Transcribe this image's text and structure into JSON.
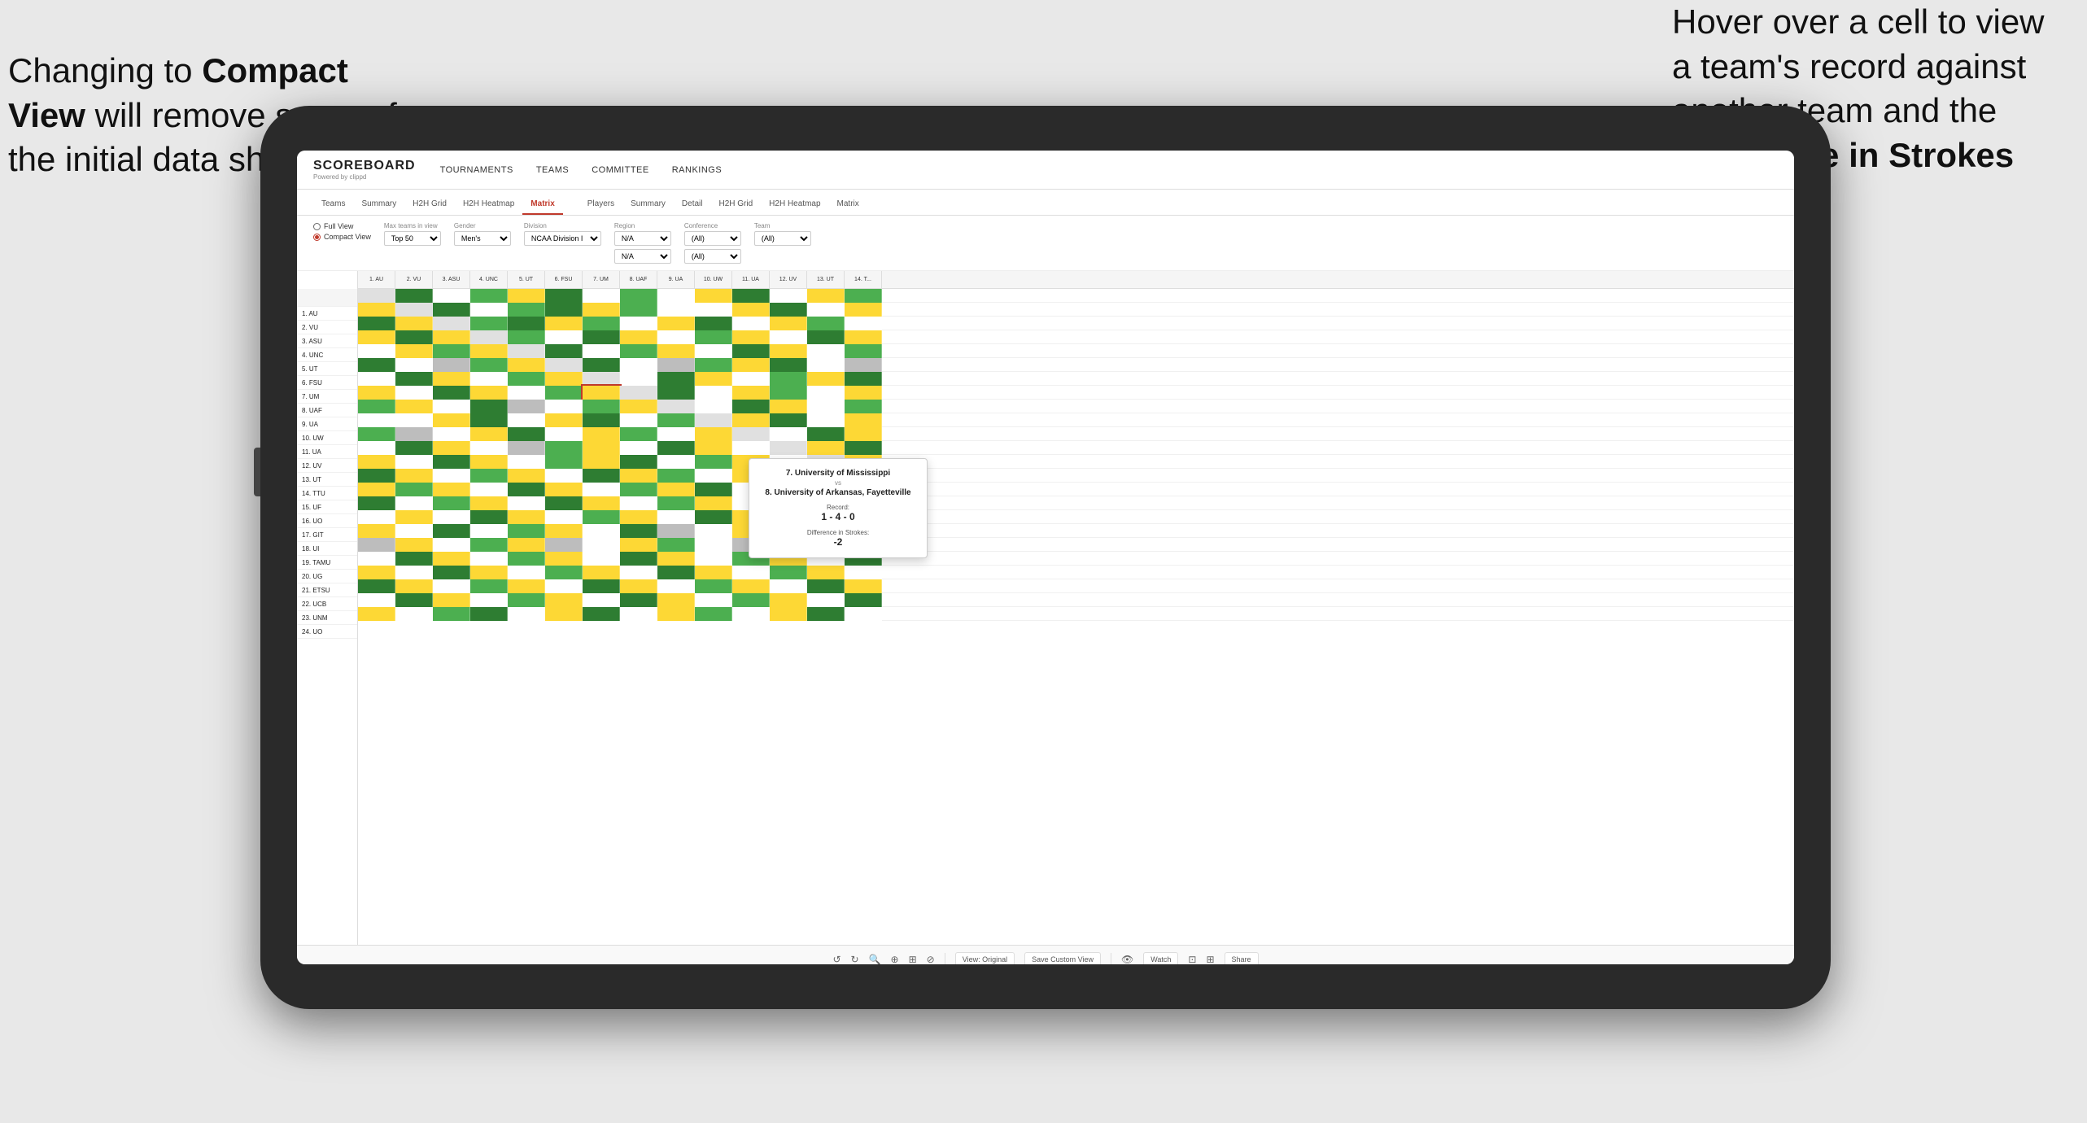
{
  "annotations": {
    "left_text": "Changing to Compact View will remove some of the initial data shown",
    "left_bold": "Compact View",
    "right_text": "Hover over a cell to view a team's record against another team and the Difference in Strokes",
    "right_bold": "Difference in Strokes"
  },
  "navbar": {
    "logo": "SCOREBOARD",
    "logo_sub": "Powered by clippd",
    "links": [
      "TOURNAMENTS",
      "TEAMS",
      "COMMITTEE",
      "RANKINGS"
    ]
  },
  "subtabs": {
    "group1": [
      "Teams",
      "Summary",
      "H2H Grid",
      "H2H Heatmap",
      "Matrix"
    ],
    "group2": [
      "Players",
      "Summary",
      "Detail",
      "H2H Grid",
      "H2H Heatmap",
      "Matrix"
    ]
  },
  "active_tab": "Matrix",
  "controls": {
    "view_full": "Full View",
    "view_compact": "Compact View",
    "max_teams_label": "Max teams in view",
    "max_teams_value": "Top 50",
    "gender_label": "Gender",
    "gender_value": "Men's",
    "division_label": "Division",
    "division_value": "NCAA Division I",
    "region_label": "Region",
    "region_value": "N/A",
    "conference_label": "Conference",
    "conference_value": "(All)",
    "team_label": "Team",
    "team_value": "(All)"
  },
  "column_headers": [
    "1. AU",
    "2. VU",
    "3. ASU",
    "4. UNC",
    "5. UT",
    "6. FSU",
    "7. UM",
    "8. UAF",
    "9. UA",
    "10. UW",
    "11. UA",
    "12. UV",
    "13. UT",
    "14. T..."
  ],
  "teams": [
    "1. AU",
    "2. VU",
    "3. ASU",
    "4. UNC",
    "5. UT",
    "6. FSU",
    "7. UM",
    "8. UAF",
    "9. UA",
    "10. UW",
    "11. UA",
    "12. UV",
    "13. UT",
    "14. TTU",
    "15. UF",
    "16. UO",
    "17. GIT",
    "18. UI",
    "19. TAMU",
    "20. UG",
    "21. ETSU",
    "22. UCB",
    "23. UNM",
    "24. UO"
  ],
  "tooltip": {
    "team1": "7. University of Mississippi",
    "vs": "vs",
    "team2": "8. University of Arkansas, Fayetteville",
    "record_label": "Record:",
    "record_value": "1 - 4 - 0",
    "strokes_label": "Difference in Strokes:",
    "strokes_value": "-2"
  },
  "toolbar": {
    "view_original": "View: Original",
    "save_custom": "Save Custom View",
    "watch": "Watch",
    "share": "Share"
  }
}
